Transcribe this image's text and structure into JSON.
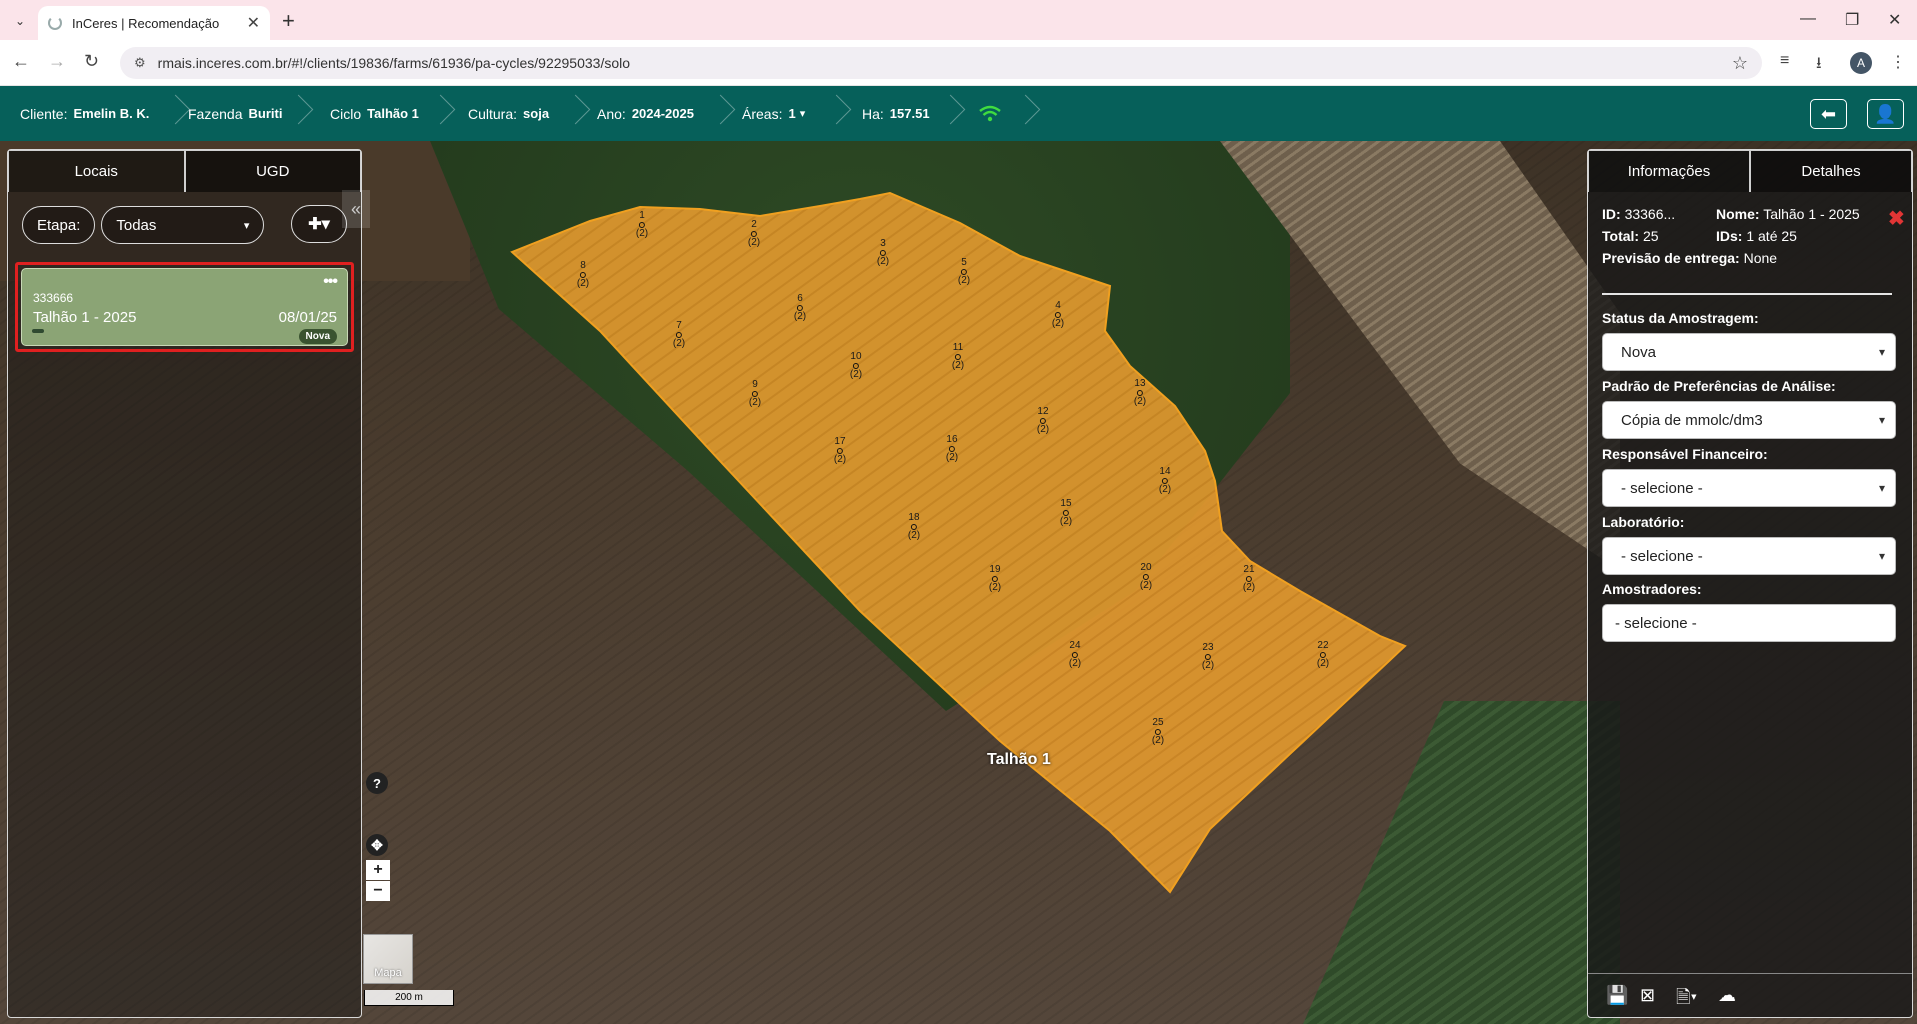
{
  "browser": {
    "tab_title": "InCeres | Recomendação",
    "url": "rmais.inceres.com.br/#!/clients/19836/farms/61936/pa-cycles/92295033/solo",
    "avatar_letter": "A"
  },
  "header": {
    "client_label": "Cliente:",
    "client_value": "Emelin B. K.",
    "farm_label": "Fazenda",
    "farm_value": "Buriti",
    "cycle_label": "Ciclo",
    "cycle_value": "Talhão 1",
    "crop_label": "Cultura:",
    "crop_value": "soja",
    "year_label": "Ano:",
    "year_value": "2024-2025",
    "areas_label": "Áreas:",
    "areas_value": "1",
    "ha_label": "Ha:",
    "ha_value": "157.51"
  },
  "left_panel": {
    "tabs": [
      "Locais",
      "UGD"
    ],
    "stage_label": "Etapa:",
    "stage_value": "Todas",
    "card": {
      "id": "333666",
      "name": "Talhão 1 - 2025",
      "date": "08/01/25",
      "badge": "Nova"
    }
  },
  "map": {
    "area_label": "Talhão 1",
    "help": "?",
    "zoom_in": "+",
    "zoom_out": "−",
    "basemap_label": "Mapa",
    "scale": "200 m",
    "samples": [
      {
        "n": "1",
        "sub": "(2)"
      },
      {
        "n": "2",
        "sub": "(2)"
      },
      {
        "n": "3",
        "sub": "(2)"
      },
      {
        "n": "4",
        "sub": "(2)"
      },
      {
        "n": "5",
        "sub": "(2)"
      },
      {
        "n": "6",
        "sub": "(2)"
      },
      {
        "n": "7",
        "sub": "(2)"
      },
      {
        "n": "8",
        "sub": "(2)"
      },
      {
        "n": "9",
        "sub": "(2)"
      },
      {
        "n": "10",
        "sub": "(2)"
      },
      {
        "n": "11",
        "sub": "(2)"
      },
      {
        "n": "12",
        "sub": "(2)"
      },
      {
        "n": "13",
        "sub": "(2)"
      },
      {
        "n": "14",
        "sub": "(2)"
      },
      {
        "n": "15",
        "sub": "(2)"
      },
      {
        "n": "16",
        "sub": "(2)"
      },
      {
        "n": "17",
        "sub": "(2)"
      },
      {
        "n": "18",
        "sub": "(2)"
      },
      {
        "n": "19",
        "sub": "(2)"
      },
      {
        "n": "20",
        "sub": "(2)"
      },
      {
        "n": "21",
        "sub": "(2)"
      },
      {
        "n": "22",
        "sub": "(2)"
      },
      {
        "n": "23",
        "sub": "(2)"
      },
      {
        "n": "24",
        "sub": "(2)"
      },
      {
        "n": "25",
        "sub": "(2)"
      }
    ]
  },
  "right_panel": {
    "tabs": [
      "Informações",
      "Detalhes"
    ],
    "id_label": "ID:",
    "id_value": "33366...",
    "name_label": "Nome:",
    "name_value": "Talhão 1 - 2025",
    "total_label": "Total:",
    "total_value": "25",
    "ids_label": "IDs:",
    "ids_value": "1 até 25",
    "delivery_label": "Previsão de entrega:",
    "delivery_value": "None",
    "status_label": "Status da Amostragem:",
    "status_value": "Nova",
    "pref_label": "Padrão de Preferências de Análise:",
    "pref_value": "Cópia de mmolc/dm3",
    "finance_label": "Responsável Financeiro:",
    "finance_value": "- selecione -",
    "lab_label": "Laboratório:",
    "lab_value": "- selecione -",
    "samplers_label": "Amostradores:",
    "samplers_value": "- selecione -"
  },
  "colors": {
    "header_bg": "#06605a",
    "polygon_fill": "#e89a2b",
    "card_bg": "#8ba475",
    "highlight": "#e02020"
  }
}
